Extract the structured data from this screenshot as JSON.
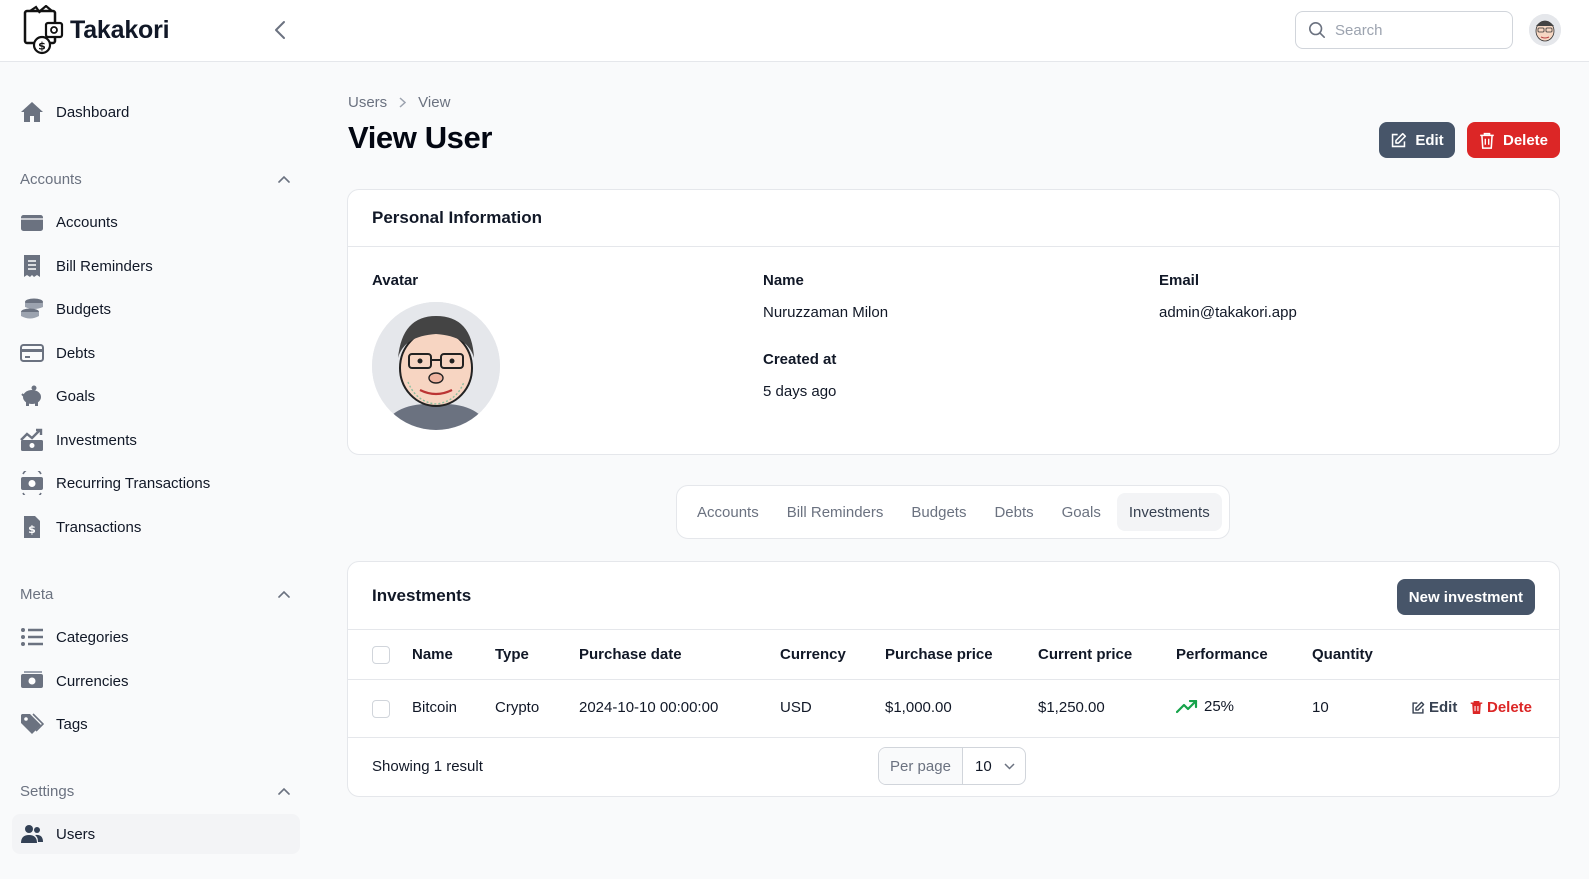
{
  "app": {
    "name": "Takakori"
  },
  "search": {
    "placeholder": "Search"
  },
  "sidebar": {
    "dashboard": {
      "label": "Dashboard",
      "icon": "home-icon"
    },
    "groups": [
      {
        "label": "Accounts",
        "items": [
          {
            "label": "Accounts",
            "icon": "wallet-icon"
          },
          {
            "label": "Bill Reminders",
            "icon": "receipt-icon"
          },
          {
            "label": "Budgets",
            "icon": "coins-icon"
          },
          {
            "label": "Debts",
            "icon": "credit-card-icon"
          },
          {
            "label": "Goals",
            "icon": "piggy-bank-icon"
          },
          {
            "label": "Investments",
            "icon": "chart-trend-icon"
          },
          {
            "label": "Recurring Transactions",
            "icon": "recurring-money-icon"
          },
          {
            "label": "Transactions",
            "icon": "document-dollar-icon"
          }
        ]
      },
      {
        "label": "Meta",
        "items": [
          {
            "label": "Categories",
            "icon": "list-icon"
          },
          {
            "label": "Currencies",
            "icon": "banknotes-icon"
          },
          {
            "label": "Tags",
            "icon": "tag-icon"
          }
        ]
      },
      {
        "label": "Settings",
        "items": [
          {
            "label": "Users",
            "icon": "users-icon",
            "active": true
          }
        ]
      }
    ]
  },
  "breadcrumb": [
    "Users",
    "View"
  ],
  "page": {
    "title": "View User",
    "edit_label": "Edit",
    "delete_label": "Delete"
  },
  "personal_info": {
    "title": "Personal Information",
    "avatar_label": "Avatar",
    "name_label": "Name",
    "name_value": "Nuruzzaman Milon",
    "email_label": "Email",
    "email_value": "admin@takakori.app",
    "created_label": "Created at",
    "created_value": "5 days ago"
  },
  "tabs": [
    {
      "label": "Accounts"
    },
    {
      "label": "Bill Reminders"
    },
    {
      "label": "Budgets"
    },
    {
      "label": "Debts"
    },
    {
      "label": "Goals"
    },
    {
      "label": "Investments",
      "active": true
    }
  ],
  "investments": {
    "title": "Investments",
    "new_button": "New investment",
    "columns": [
      "Name",
      "Type",
      "Purchase date",
      "Currency",
      "Purchase price",
      "Current price",
      "Performance",
      "Quantity"
    ],
    "rows": [
      {
        "name": "Bitcoin",
        "type": "Crypto",
        "purchase_date": "2024-10-10 00:00:00",
        "currency": "USD",
        "purchase_price": "$1,000.00",
        "current_price": "$1,250.00",
        "performance": "25%",
        "quantity": "10",
        "edit_label": "Edit",
        "delete_label": "Delete"
      }
    ],
    "footer_text": "Showing 1 result",
    "per_page_label": "Per page",
    "per_page_value": "10"
  },
  "colors": {
    "primary_slate": "#475569",
    "danger": "#dc2626",
    "success": "#16a34a",
    "sidebar_icon": "#6b7280"
  }
}
